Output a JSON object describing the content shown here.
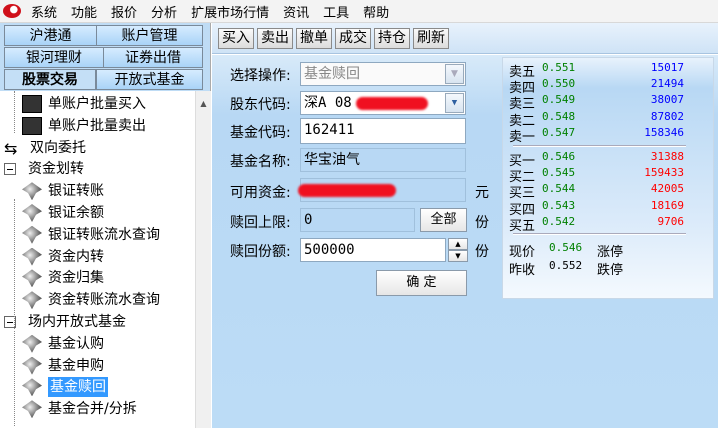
{
  "menu": [
    "系统",
    "功能",
    "报价",
    "分析",
    "扩展市场行情",
    "资讯",
    "工具",
    "帮助"
  ],
  "tabs": [
    [
      "沪港通",
      "账户管理"
    ],
    [
      "银河理财",
      "证券出借"
    ],
    [
      "股票交易",
      "开放式基金"
    ]
  ],
  "tree": [
    {
      "label": "单账户批量买入",
      "icon": "buy-device-icon",
      "level": 2
    },
    {
      "label": "单账户批量卖出",
      "icon": "sell-device-icon",
      "level": 2
    },
    {
      "label": "双向委托",
      "icon": "two-way-arrows-icon",
      "level": 1
    },
    {
      "label": "资金划转",
      "icon": "collapse-icon",
      "level": 1
    },
    {
      "label": "银证转账",
      "icon": "gem-icon",
      "level": 2
    },
    {
      "label": "银证余额",
      "icon": "gem-icon",
      "level": 2
    },
    {
      "label": "银证转账流水查询",
      "icon": "gem-icon",
      "level": 2
    },
    {
      "label": "资金内转",
      "icon": "gem-icon",
      "level": 2
    },
    {
      "label": "资金归集",
      "icon": "gem-icon",
      "level": 2
    },
    {
      "label": "资金转账流水查询",
      "icon": "gem-icon",
      "level": 2
    },
    {
      "label": "场内开放式基金",
      "icon": "collapse-icon",
      "level": 1
    },
    {
      "label": "基金认购",
      "icon": "gem-icon",
      "level": 2
    },
    {
      "label": "基金申购",
      "icon": "gem-icon",
      "level": 2
    },
    {
      "label": "基金赎回",
      "icon": "gem-icon",
      "level": 2,
      "selected": true
    },
    {
      "label": "基金合并/分拆",
      "icon": "gem-icon",
      "level": 2
    }
  ],
  "toolbar": [
    "买入",
    "卖出",
    "撤单",
    "成交",
    "持仓",
    "刷新"
  ],
  "form": {
    "op_label": "选择操作:",
    "op_value": "基金赎回",
    "holder_label": "股东代码:",
    "holder_value": "深A 08",
    "code_label": "基金代码:",
    "code_value": "162411",
    "name_label": "基金名称:",
    "name_value": "华宝油气",
    "funds_label": "可用资金:",
    "funds_unit": "元",
    "limit_label": "赎回上限:",
    "limit_value": "0",
    "all_button": "全部",
    "limit_unit": "份",
    "qty_label": "赎回份额:",
    "qty_value": "500000",
    "qty_unit": "份",
    "confirm": "确 定"
  },
  "quote": {
    "sell": [
      [
        "卖五",
        "0.551",
        "15017"
      ],
      [
        "卖四",
        "0.550",
        "21494"
      ],
      [
        "卖三",
        "0.549",
        "38007"
      ],
      [
        "卖二",
        "0.548",
        "87802"
      ],
      [
        "卖一",
        "0.547",
        "158346"
      ]
    ],
    "buy": [
      [
        "买一",
        "0.546",
        "31388"
      ],
      [
        "买二",
        "0.545",
        "159433"
      ],
      [
        "买三",
        "0.544",
        "42005"
      ],
      [
        "买四",
        "0.543",
        "18169"
      ],
      [
        "买五",
        "0.542",
        "9706"
      ]
    ],
    "now_label": "现价",
    "now": "0.546",
    "limit_up_label": "涨停",
    "prev_label": "昨收",
    "prev": "0.552",
    "limit_down_label": "跌停",
    "colors": {
      "price": "#008000",
      "sell_vol": "#0000ff",
      "buy_vol": "#ff0000"
    }
  }
}
